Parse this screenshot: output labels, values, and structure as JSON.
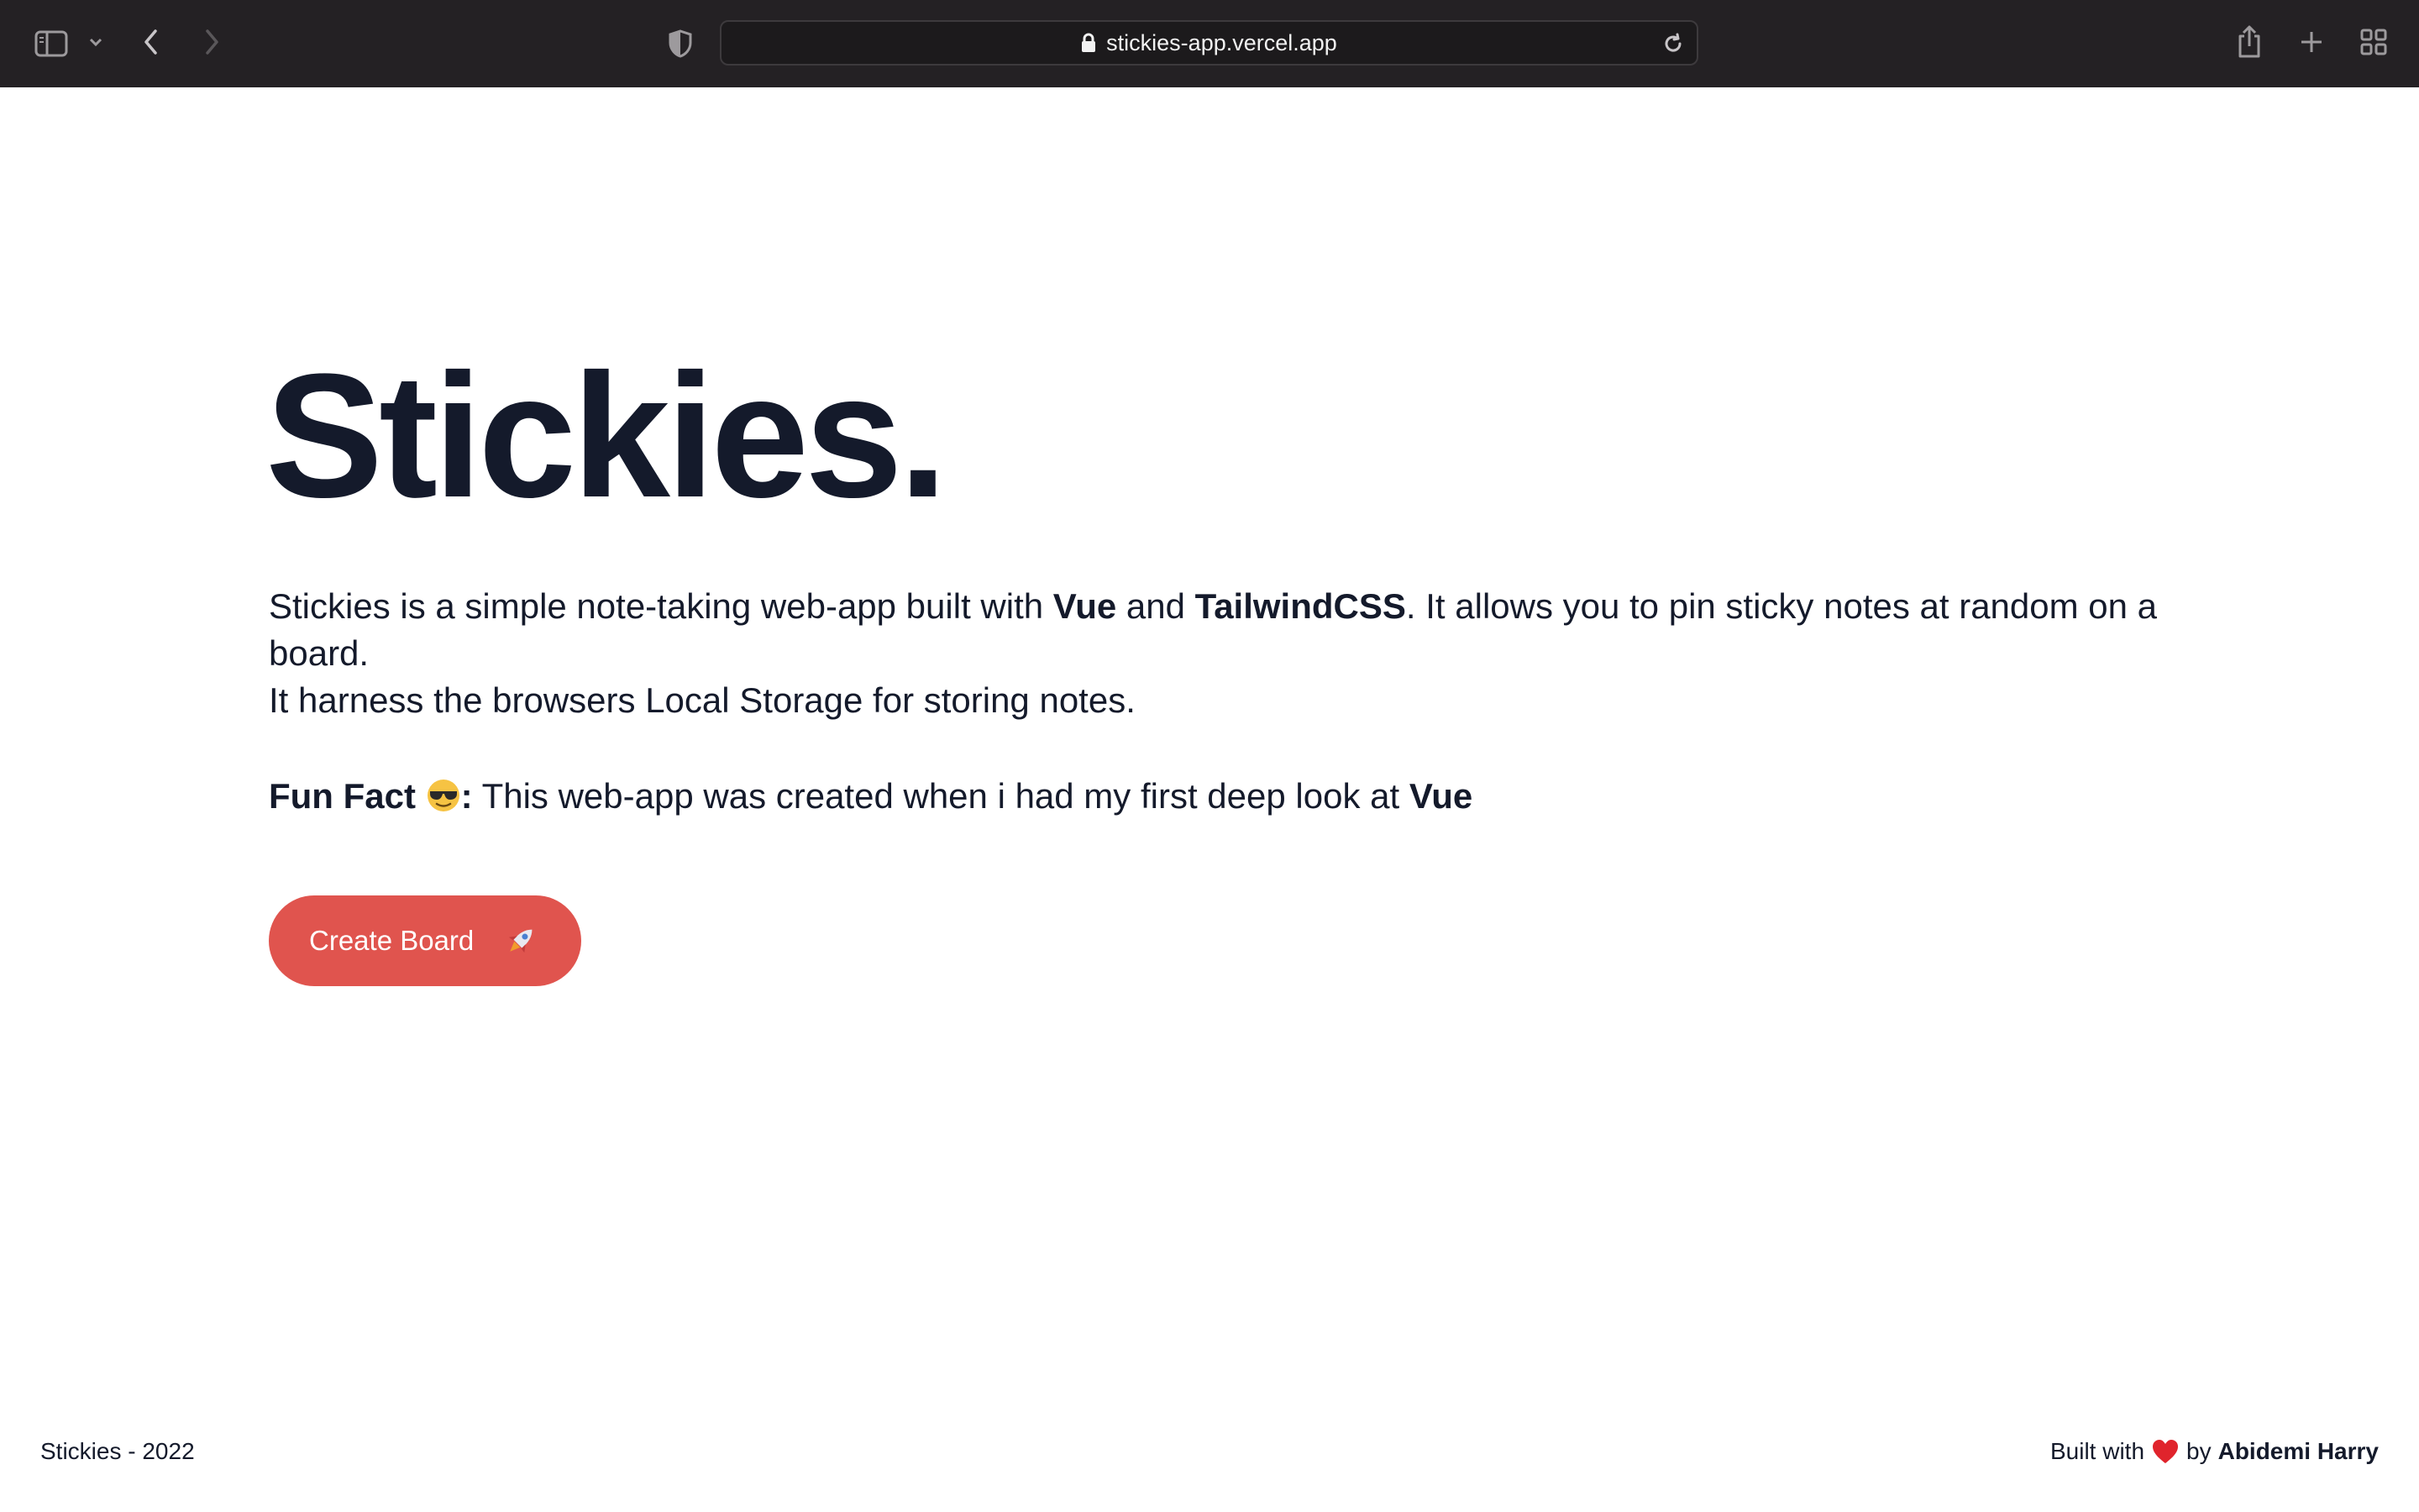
{
  "browser": {
    "url": "stickies-app.vercel.app",
    "icons": [
      "sidebar-icon",
      "chevron-down-icon",
      "back-icon",
      "forward-icon",
      "shield-icon",
      "lock-icon",
      "reload-icon",
      "share-icon",
      "new-tab-icon",
      "tab-overview-icon"
    ]
  },
  "hero": {
    "title": "Stickies.",
    "intro_1": "Stickies is a simple note-taking web-app built with ",
    "tech_1": "Vue",
    "intro_2": " and ",
    "tech_2": "TailwindCSS",
    "intro_3": ". It allows you to pin sticky notes at random on a board.",
    "intro_4": "It harness the browsers Local Storage for storing notes.",
    "funfact_label": "Fun Fact",
    "funfact_colon": ":",
    "funfact_text": " This web-app was created when i had my first deep look at ",
    "funfact_tech": "Vue",
    "button_label": "Create Board"
  },
  "footer": {
    "left": "Stickies - 2022",
    "built_with": "Built with",
    "by": "by",
    "author": "Abidemi Harry"
  },
  "colors": {
    "text": "#141a2b",
    "button": "#e0544e",
    "toolbar": "#242124"
  }
}
